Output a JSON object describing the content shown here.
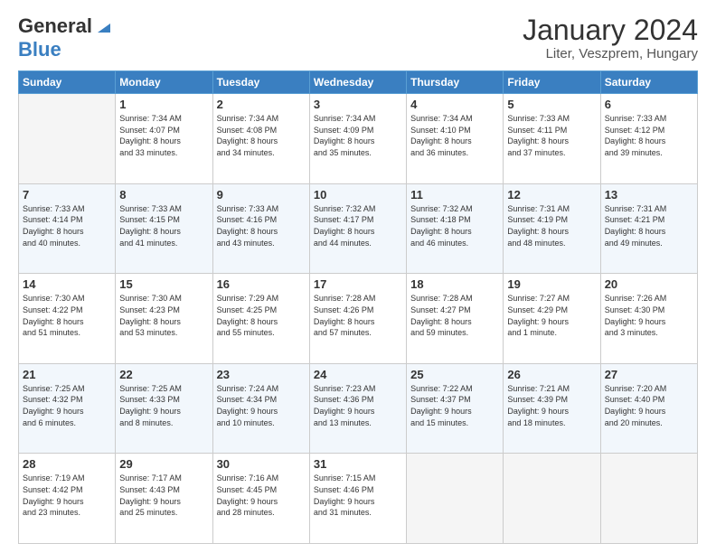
{
  "header": {
    "logo_line1": "General",
    "logo_line2": "Blue",
    "title": "January 2024",
    "subtitle": "Liter, Veszprem, Hungary"
  },
  "days_of_week": [
    "Sunday",
    "Monday",
    "Tuesday",
    "Wednesday",
    "Thursday",
    "Friday",
    "Saturday"
  ],
  "weeks": [
    [
      {
        "day": "",
        "info": ""
      },
      {
        "day": "1",
        "info": "Sunrise: 7:34 AM\nSunset: 4:07 PM\nDaylight: 8 hours\nand 33 minutes."
      },
      {
        "day": "2",
        "info": "Sunrise: 7:34 AM\nSunset: 4:08 PM\nDaylight: 8 hours\nand 34 minutes."
      },
      {
        "day": "3",
        "info": "Sunrise: 7:34 AM\nSunset: 4:09 PM\nDaylight: 8 hours\nand 35 minutes."
      },
      {
        "day": "4",
        "info": "Sunrise: 7:34 AM\nSunset: 4:10 PM\nDaylight: 8 hours\nand 36 minutes."
      },
      {
        "day": "5",
        "info": "Sunrise: 7:33 AM\nSunset: 4:11 PM\nDaylight: 8 hours\nand 37 minutes."
      },
      {
        "day": "6",
        "info": "Sunrise: 7:33 AM\nSunset: 4:12 PM\nDaylight: 8 hours\nand 39 minutes."
      }
    ],
    [
      {
        "day": "7",
        "info": "Sunrise: 7:33 AM\nSunset: 4:14 PM\nDaylight: 8 hours\nand 40 minutes."
      },
      {
        "day": "8",
        "info": "Sunrise: 7:33 AM\nSunset: 4:15 PM\nDaylight: 8 hours\nand 41 minutes."
      },
      {
        "day": "9",
        "info": "Sunrise: 7:33 AM\nSunset: 4:16 PM\nDaylight: 8 hours\nand 43 minutes."
      },
      {
        "day": "10",
        "info": "Sunrise: 7:32 AM\nSunset: 4:17 PM\nDaylight: 8 hours\nand 44 minutes."
      },
      {
        "day": "11",
        "info": "Sunrise: 7:32 AM\nSunset: 4:18 PM\nDaylight: 8 hours\nand 46 minutes."
      },
      {
        "day": "12",
        "info": "Sunrise: 7:31 AM\nSunset: 4:19 PM\nDaylight: 8 hours\nand 48 minutes."
      },
      {
        "day": "13",
        "info": "Sunrise: 7:31 AM\nSunset: 4:21 PM\nDaylight: 8 hours\nand 49 minutes."
      }
    ],
    [
      {
        "day": "14",
        "info": "Sunrise: 7:30 AM\nSunset: 4:22 PM\nDaylight: 8 hours\nand 51 minutes."
      },
      {
        "day": "15",
        "info": "Sunrise: 7:30 AM\nSunset: 4:23 PM\nDaylight: 8 hours\nand 53 minutes."
      },
      {
        "day": "16",
        "info": "Sunrise: 7:29 AM\nSunset: 4:25 PM\nDaylight: 8 hours\nand 55 minutes."
      },
      {
        "day": "17",
        "info": "Sunrise: 7:28 AM\nSunset: 4:26 PM\nDaylight: 8 hours\nand 57 minutes."
      },
      {
        "day": "18",
        "info": "Sunrise: 7:28 AM\nSunset: 4:27 PM\nDaylight: 8 hours\nand 59 minutes."
      },
      {
        "day": "19",
        "info": "Sunrise: 7:27 AM\nSunset: 4:29 PM\nDaylight: 9 hours\nand 1 minute."
      },
      {
        "day": "20",
        "info": "Sunrise: 7:26 AM\nSunset: 4:30 PM\nDaylight: 9 hours\nand 3 minutes."
      }
    ],
    [
      {
        "day": "21",
        "info": "Sunrise: 7:25 AM\nSunset: 4:32 PM\nDaylight: 9 hours\nand 6 minutes."
      },
      {
        "day": "22",
        "info": "Sunrise: 7:25 AM\nSunset: 4:33 PM\nDaylight: 9 hours\nand 8 minutes."
      },
      {
        "day": "23",
        "info": "Sunrise: 7:24 AM\nSunset: 4:34 PM\nDaylight: 9 hours\nand 10 minutes."
      },
      {
        "day": "24",
        "info": "Sunrise: 7:23 AM\nSunset: 4:36 PM\nDaylight: 9 hours\nand 13 minutes."
      },
      {
        "day": "25",
        "info": "Sunrise: 7:22 AM\nSunset: 4:37 PM\nDaylight: 9 hours\nand 15 minutes."
      },
      {
        "day": "26",
        "info": "Sunrise: 7:21 AM\nSunset: 4:39 PM\nDaylight: 9 hours\nand 18 minutes."
      },
      {
        "day": "27",
        "info": "Sunrise: 7:20 AM\nSunset: 4:40 PM\nDaylight: 9 hours\nand 20 minutes."
      }
    ],
    [
      {
        "day": "28",
        "info": "Sunrise: 7:19 AM\nSunset: 4:42 PM\nDaylight: 9 hours\nand 23 minutes."
      },
      {
        "day": "29",
        "info": "Sunrise: 7:17 AM\nSunset: 4:43 PM\nDaylight: 9 hours\nand 25 minutes."
      },
      {
        "day": "30",
        "info": "Sunrise: 7:16 AM\nSunset: 4:45 PM\nDaylight: 9 hours\nand 28 minutes."
      },
      {
        "day": "31",
        "info": "Sunrise: 7:15 AM\nSunset: 4:46 PM\nDaylight: 9 hours\nand 31 minutes."
      },
      {
        "day": "",
        "info": ""
      },
      {
        "day": "",
        "info": ""
      },
      {
        "day": "",
        "info": ""
      }
    ]
  ]
}
